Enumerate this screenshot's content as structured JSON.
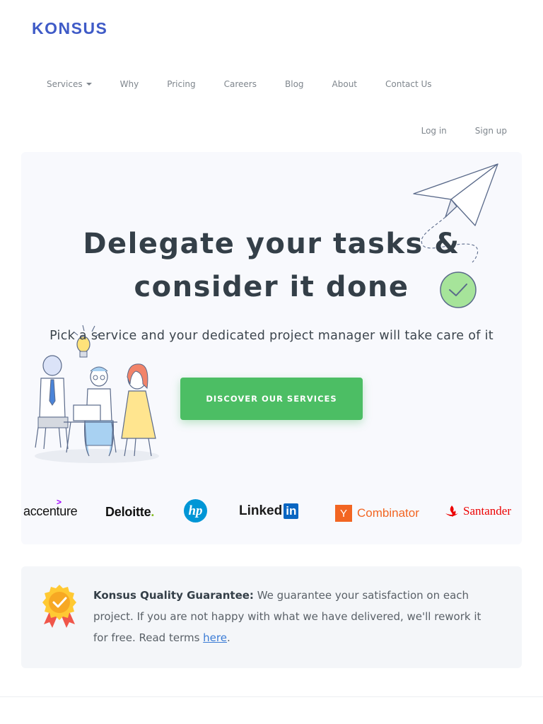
{
  "brand": {
    "name": "KONSUS"
  },
  "nav": {
    "items": [
      {
        "label": "Services",
        "has_dropdown": true
      },
      {
        "label": "Why"
      },
      {
        "label": "Pricing"
      },
      {
        "label": "Careers"
      },
      {
        "label": "Blog"
      },
      {
        "label": "About"
      },
      {
        "label": "Contact Us"
      }
    ]
  },
  "auth": {
    "login": "Log in",
    "signup": "Sign up"
  },
  "hero": {
    "title_line1": "Delegate your tasks &",
    "title_line2": "consider it done",
    "subtitle": "Pick a service and your dedicated project manager will take care of it",
    "cta": "DISCOVER OUR SERVICES"
  },
  "clients": {
    "accenture": "accenture",
    "deloitte": "Deloitte",
    "deloitte_dot": ".",
    "hp": "hp",
    "linkedin_text": "Linked",
    "linkedin_in": "in",
    "ycomb_y": "Y",
    "ycomb_text": "Combinator",
    "santander": "Santander"
  },
  "guarantee": {
    "title": "Konsus Quality Guarantee:",
    "text": " We guarantee your satisfaction on each project. If you are not happy with what we have delivered, we'll rework it for free. Read terms ",
    "link": "here",
    "end": "."
  },
  "colors": {
    "brand": "#3f5bc7",
    "cta": "#4cbe64",
    "hero_bg": "#f8f9fd",
    "guarantee_bg": "#f4f6f9"
  }
}
